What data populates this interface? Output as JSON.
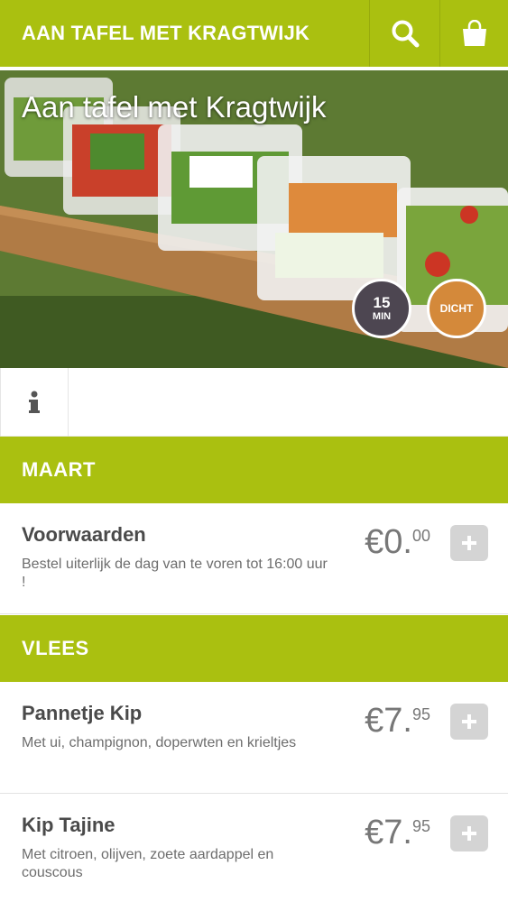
{
  "header": {
    "title": "AAN TAFEL MET KRAGTWIJK",
    "search_icon": "search-icon",
    "cart_icon": "shopping-bag-icon",
    "brand_color": "#aac010"
  },
  "hero": {
    "title": "Aan tafel met Kragtwijk",
    "time_badge": {
      "value": "15",
      "unit": "MIN"
    },
    "status_badge": "DICHT"
  },
  "info": {
    "icon": "info-icon"
  },
  "sections": [
    {
      "label": "MAART",
      "items": [
        {
          "name": "Voorwaarden",
          "description": "Bestel uiterlijk de dag van te voren tot 16:00 uur !",
          "price_currency_whole": "€0.",
          "price_cents": "00"
        }
      ]
    },
    {
      "label": "VLEES",
      "items": [
        {
          "name": "Pannetje Kip",
          "description": "Met ui, champignon, doperwten en krieltjes",
          "price_currency_whole": "€7.",
          "price_cents": "95"
        },
        {
          "name": "Kip Tajine",
          "description": "Met citroen, olijven, zoete aardappel en couscous",
          "price_currency_whole": "€7.",
          "price_cents": "95"
        }
      ]
    }
  ]
}
